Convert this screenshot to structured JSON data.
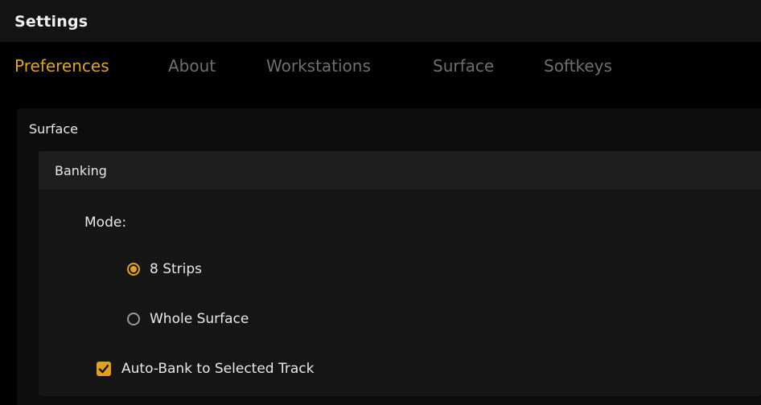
{
  "window": {
    "title": "Settings"
  },
  "tabs": [
    {
      "label": "Preferences",
      "active": true
    },
    {
      "label": "About",
      "active": false
    },
    {
      "label": "Workstations",
      "active": false
    },
    {
      "label": "Surface",
      "active": false
    },
    {
      "label": "Softkeys",
      "active": false
    }
  ],
  "section": {
    "title": "Surface",
    "group": {
      "title": "Banking",
      "mode_label": "Mode:",
      "options": [
        {
          "label": "8 Strips",
          "selected": true
        },
        {
          "label": "Whole Surface",
          "selected": false
        }
      ],
      "auto_bank": {
        "label": "Auto-Bank to Selected Track",
        "checked": true
      }
    }
  },
  "colors": {
    "accent": "#e3a21c",
    "inactive_tab": "#6f6f6f",
    "background": "#000000"
  }
}
